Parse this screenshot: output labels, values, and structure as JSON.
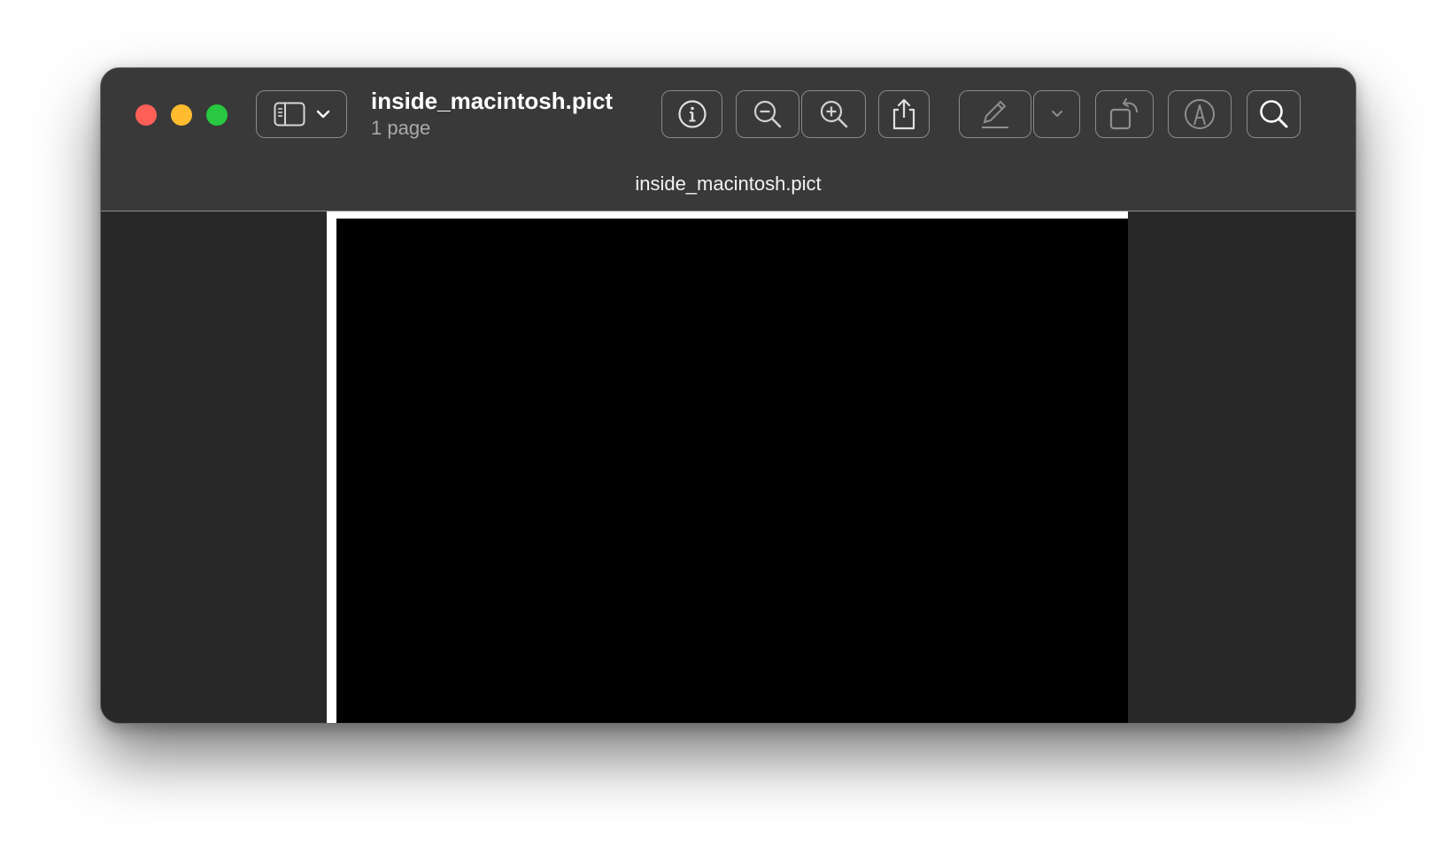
{
  "window": {
    "title": "inside_macintosh.pict",
    "subtitle": "1 page",
    "tab_title": "inside_macintosh.pict",
    "traffic_lights": {
      "close": "#fe5f57",
      "minimize": "#febc2e",
      "zoom": "#28c840"
    }
  },
  "toolbar": {
    "buttons": [
      {
        "name": "sidebar-toggle-button",
        "icon": "sidebar-icon"
      },
      {
        "name": "sidebar-dropdown",
        "icon": "chevron-down-icon"
      },
      {
        "name": "info-button",
        "icon": "info-icon"
      },
      {
        "name": "zoom-out-button",
        "icon": "zoom-out-icon"
      },
      {
        "name": "zoom-in-button",
        "icon": "zoom-in-icon"
      },
      {
        "name": "share-button",
        "icon": "share-icon"
      },
      {
        "name": "markup-button",
        "icon": "pencil-icon"
      },
      {
        "name": "markup-dropdown",
        "icon": "chevron-down-icon"
      },
      {
        "name": "rotate-button",
        "icon": "rotate-icon"
      },
      {
        "name": "annotate-button",
        "icon": "markup-icon"
      },
      {
        "name": "search-button",
        "icon": "search-icon"
      }
    ]
  },
  "document": {
    "page_background": "#ffffff",
    "image_fill": "#000000"
  }
}
